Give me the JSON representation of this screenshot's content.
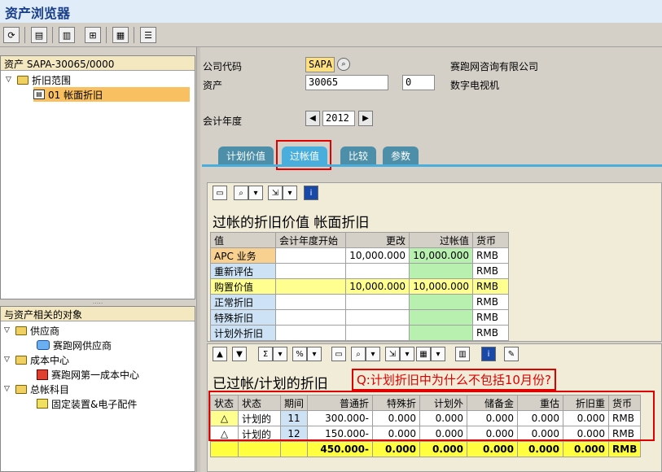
{
  "window": {
    "title": "资产浏览器"
  },
  "toolbar": {
    "icons": [
      "refresh-icon",
      "layout-icon",
      "report-icon",
      "export-icon",
      "grid-icon",
      "list-icon"
    ]
  },
  "left_tree": {
    "header": "资产 SAPA-30065/0000",
    "root": "折旧范围",
    "child": "01  帐面折旧"
  },
  "related_tree": {
    "header": "与资产相关的对象",
    "vendor_folder": "供应商",
    "vendor_item": "赛跑网供应商",
    "cc_folder": "成本中心",
    "cc_item": "赛跑网第一成本中心",
    "gl_folder": "总帐科目",
    "gl_item": "固定装置&电子配件"
  },
  "header_fields": {
    "company_code_label": "公司代码",
    "company_code": "SAPA",
    "company_name": "赛跑网咨询有限公司",
    "asset_label": "资产",
    "asset_number": "30065",
    "sub_number": "0",
    "asset_name": "数字电视机",
    "fiscal_year_label": "会计年度",
    "fiscal_year": "2012"
  },
  "tabs": [
    "计划价值",
    "过帐值",
    "比较",
    "参数"
  ],
  "posted_values": {
    "title": "过帐的折旧价值 帐面折旧",
    "columns": [
      "值",
      "会计年度开始",
      "更改",
      "过帐值",
      "货币"
    ],
    "rows": [
      {
        "name": "APC 业务",
        "start": "",
        "change": "10,000.000",
        "posted": "10,000.000",
        "cur": "RMB"
      },
      {
        "name": "重新评估",
        "start": "",
        "change": "",
        "posted": "",
        "cur": "RMB"
      },
      {
        "name": "购置价值",
        "start": "",
        "change": "10,000.000",
        "posted": "10,000.000",
        "cur": "RMB"
      },
      {
        "name": "正常折旧",
        "start": "",
        "change": "",
        "posted": "",
        "cur": "RMB"
      },
      {
        "name": "特殊折旧",
        "start": "",
        "change": "",
        "posted": "",
        "cur": "RMB"
      },
      {
        "name": "计划外折旧",
        "start": "",
        "change": "",
        "posted": "",
        "cur": "RMB"
      }
    ]
  },
  "depr_values": {
    "title": "已过帐/计划的折旧",
    "question": "Q:计划折旧中为什么不包括10月份?",
    "columns": [
      "状态",
      "状态",
      "期间",
      "普通折",
      "特殊折",
      "计划外",
      "储备金",
      "重估",
      "折旧重",
      "货币"
    ],
    "rows": [
      {
        "icon": "△",
        "status": "计划的",
        "period": "11",
        "ordinary": "300.000-",
        "special": "0.000",
        "unplanned": "0.000",
        "reserve": "0.000",
        "reval": "0.000",
        "depr": "0.000",
        "cur": "RMB"
      },
      {
        "icon": "△",
        "status": "计划的",
        "period": "12",
        "ordinary": "150.000-",
        "special": "0.000",
        "unplanned": "0.000",
        "reserve": "0.000",
        "reval": "0.000",
        "depr": "0.000",
        "cur": "RMB"
      }
    ],
    "sum": {
      "ordinary": "450.000-",
      "special": "0.000",
      "unplanned": "0.000",
      "reserve": "0.000",
      "reval": "0.000",
      "depr": "0.000",
      "cur": "RMB"
    }
  }
}
